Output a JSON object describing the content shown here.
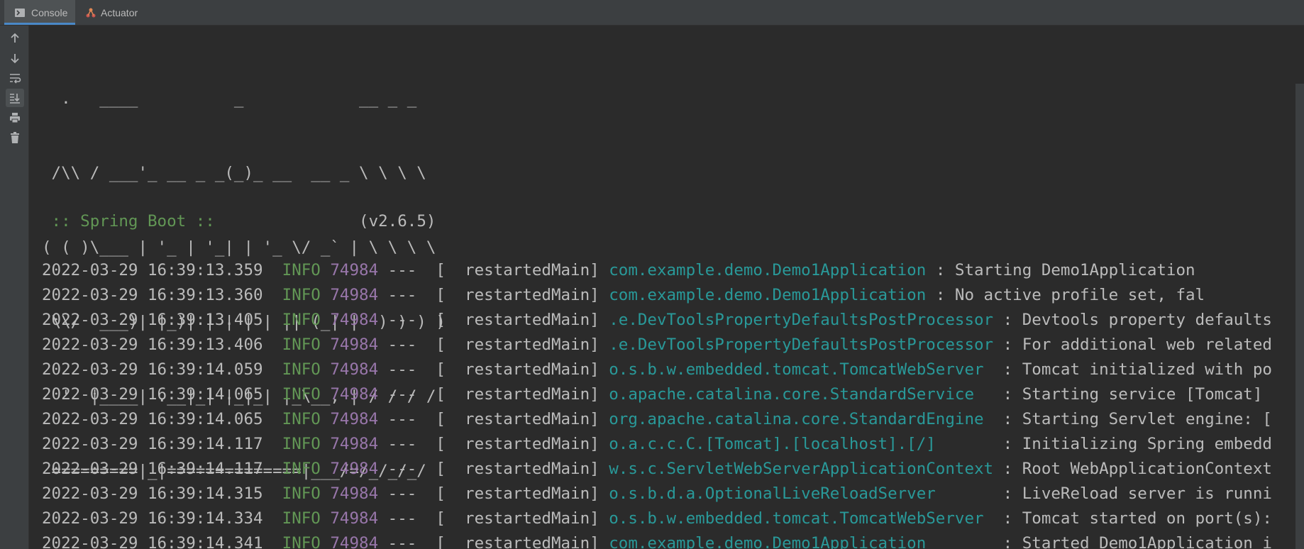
{
  "tabs": [
    {
      "label": "Console",
      "icon": "console-icon",
      "active": true
    },
    {
      "label": "Actuator",
      "icon": "actuator-icon",
      "active": false
    }
  ],
  "sidebar": {
    "tools": [
      "scroll-up-icon",
      "scroll-down-icon",
      "soft-wrap-icon",
      "scroll-to-end-icon",
      "print-icon",
      "clear-all-icon"
    ]
  },
  "banner": {
    "lines": [
      "  .   ____          _            __ _ _",
      " /\\\\ / ___'_ __ _ _(_)_ __  __ _ \\ \\ \\ \\",
      "( ( )\\___ | '_ | '_| | '_ \\/ _` | \\ \\ \\ \\",
      " \\\\/  ___)| |_)| | | | | || (_| |  ) ) ) )",
      "  '  |____| .__|_| |_|_| |_\\__, | / / / /",
      " =========|_|==============|___/=/_/_/_/"
    ],
    "spring_label": " :: Spring Boot :: ",
    "spring_version": "              (v2.6.5)"
  },
  "log": [
    {
      "ts": "2022-03-29 16:39:13.359",
      "level": "INFO",
      "pid": "74984",
      "thread": "---  [  restartedMain]",
      "logger": "com.example.demo.Demo1Application",
      "msg": ": Starting Demo1Application"
    },
    {
      "ts": "2022-03-29 16:39:13.360",
      "level": "INFO",
      "pid": "74984",
      "thread": "---  [  restartedMain]",
      "logger": "com.example.demo.Demo1Application",
      "msg": ": No active profile set, fal"
    },
    {
      "ts": "2022-03-29 16:39:13.405",
      "level": "INFO",
      "pid": "74984",
      "thread": "---  [  restartedMain]",
      "logger": ".e.DevToolsPropertyDefaultsPostProcessor",
      "msg": ": Devtools property defaults"
    },
    {
      "ts": "2022-03-29 16:39:13.406",
      "level": "INFO",
      "pid": "74984",
      "thread": "---  [  restartedMain]",
      "logger": ".e.DevToolsPropertyDefaultsPostProcessor",
      "msg": ": For additional web related"
    },
    {
      "ts": "2022-03-29 16:39:14.059",
      "level": "INFO",
      "pid": "74984",
      "thread": "---  [  restartedMain]",
      "logger": "o.s.b.w.embedded.tomcat.TomcatWebServer",
      "msg": " : Tomcat initialized with po"
    },
    {
      "ts": "2022-03-29 16:39:14.065",
      "level": "INFO",
      "pid": "74984",
      "thread": "---  [  restartedMain]",
      "logger": "o.apache.catalina.core.StandardService",
      "msg": "  : Starting service [Tomcat]"
    },
    {
      "ts": "2022-03-29 16:39:14.065",
      "level": "INFO",
      "pid": "74984",
      "thread": "---  [  restartedMain]",
      "logger": "org.apache.catalina.core.StandardEngine",
      "msg": " : Starting Servlet engine: ["
    },
    {
      "ts": "2022-03-29 16:39:14.117",
      "level": "INFO",
      "pid": "74984",
      "thread": "---  [  restartedMain]",
      "logger": "o.a.c.c.C.[Tomcat].[localhost].[/]",
      "msg": "      : Initializing Spring embedd"
    },
    {
      "ts": "2022-03-29 16:39:14.117",
      "level": "INFO",
      "pid": "74984",
      "thread": "---  [  restartedMain]",
      "logger": "w.s.c.ServletWebServerApplicationContext",
      "msg": ": Root WebApplicationContext"
    },
    {
      "ts": "2022-03-29 16:39:14.315",
      "level": "INFO",
      "pid": "74984",
      "thread": "---  [  restartedMain]",
      "logger": "o.s.b.d.a.OptionalLiveReloadServer",
      "msg": "      : LiveReload server is runni"
    },
    {
      "ts": "2022-03-29 16:39:14.334",
      "level": "INFO",
      "pid": "74984",
      "thread": "---  [  restartedMain]",
      "logger": "o.s.b.w.embedded.tomcat.TomcatWebServer",
      "msg": " : Tomcat started on port(s):"
    },
    {
      "ts": "2022-03-29 16:39:14.341",
      "level": "INFO",
      "pid": "74984",
      "thread": "---  [  restartedMain]",
      "logger": "com.example.demo.Demo1Application",
      "msg": "       : Started Demo1Application i"
    }
  ]
}
